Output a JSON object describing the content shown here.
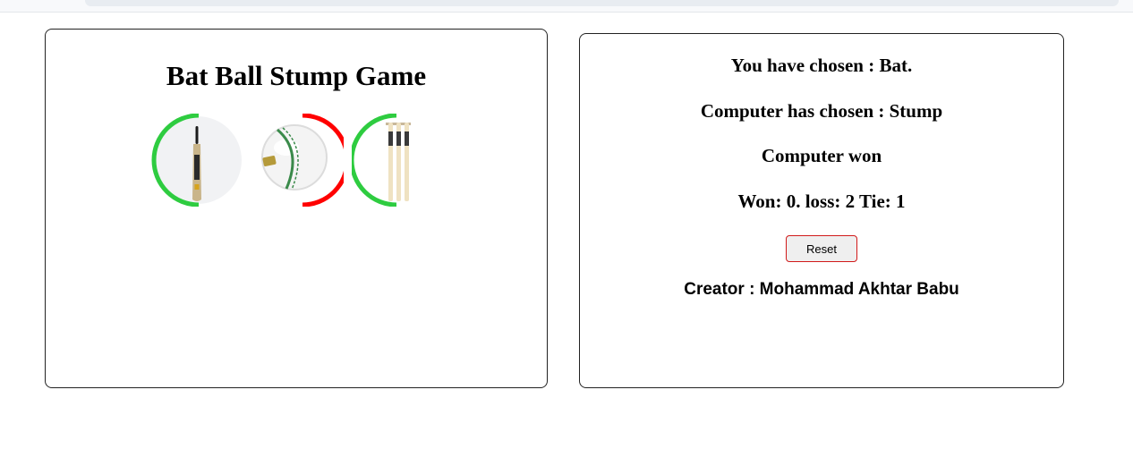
{
  "game": {
    "title": "Bat Ball Stump Game",
    "choices": [
      {
        "name": "Bat",
        "icon": "bat-icon",
        "ring_color": "#2ecc40"
      },
      {
        "name": "Ball",
        "icon": "ball-icon",
        "ring_color": "#ff0000"
      },
      {
        "name": "Stump",
        "icon": "stump-icon",
        "ring_color": "#2ecc40"
      }
    ]
  },
  "result": {
    "user_choice": "You have chosen : Bat.",
    "computer_choice": "Computer has chosen : Stump",
    "outcome": "Computer won",
    "score": "Won: 0. loss: 2 Tie: 1",
    "reset_label": "Reset",
    "creator": "Creator : Mohammad Akhtar Babu"
  },
  "colors": {
    "win_ring": "#2ecc40",
    "loss_ring": "#ff0000",
    "reset_border": "#d11a1a"
  }
}
